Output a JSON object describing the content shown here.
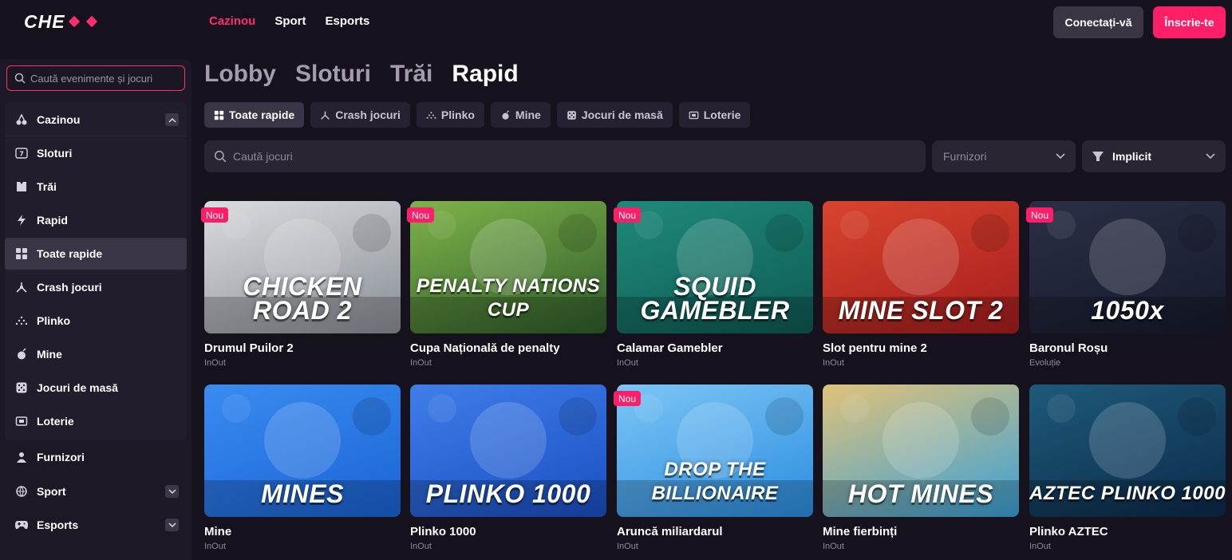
{
  "header": {
    "logo": "CHEXX",
    "nav": [
      {
        "label": "Cazinou",
        "active": true
      },
      {
        "label": "Sport",
        "active": false
      },
      {
        "label": "Esports",
        "active": false
      }
    ],
    "login_label": "Conectați-vă",
    "register_label": "Înscrie-te"
  },
  "sidebar": {
    "search_placeholder": "Caută evenimente și jocuri",
    "casino_label": "Cazinou",
    "casino_items": [
      {
        "label": "Sloturi",
        "icon": "slot-icon"
      },
      {
        "label": "Trăi",
        "icon": "live-icon"
      },
      {
        "label": "Rapid",
        "icon": "lightning-icon"
      },
      {
        "label": "Toate rapide",
        "icon": "grid-icon",
        "selected": true
      },
      {
        "label": "Crash jocuri",
        "icon": "crash-icon"
      },
      {
        "label": "Plinko",
        "icon": "plinko-icon"
      },
      {
        "label": "Mine",
        "icon": "mine-icon"
      },
      {
        "label": "Jocuri de masă",
        "icon": "dice-icon"
      },
      {
        "label": "Loterie",
        "icon": "lottery-icon"
      }
    ],
    "providers_label": "Furnizori",
    "sport_label": "Sport",
    "esports_label": "Esports"
  },
  "main": {
    "category_tabs": [
      {
        "label": "Lobby",
        "active": false
      },
      {
        "label": "Sloturi",
        "active": false
      },
      {
        "label": "Trăi",
        "active": false
      },
      {
        "label": "Rapid",
        "active": true
      }
    ],
    "chips": [
      {
        "label": "Toate rapide",
        "active": true
      },
      {
        "label": "Crash jocuri",
        "active": false
      },
      {
        "label": "Plinko",
        "active": false
      },
      {
        "label": "Mine",
        "active": false
      },
      {
        "label": "Jocuri de masă",
        "active": false
      },
      {
        "label": "Loterie",
        "active": false
      }
    ],
    "search_placeholder": "Caută jocuri",
    "providers_select": "Furnizori",
    "sort_select": "Implicit"
  },
  "games": [
    {
      "name": "Drumul Puilor 2",
      "provider": "InOut",
      "badge": "Nou",
      "art_title": "CHICKEN ROAD 2",
      "colors": [
        "#8a8f96",
        "#d9dde0"
      ]
    },
    {
      "name": "Cupa Națională de penalty",
      "provider": "InOut",
      "badge": "Nou",
      "art_title": "PENALTY NATIONS CUP",
      "colors": [
        "#2f5c2a",
        "#7fb34a"
      ]
    },
    {
      "name": "Calamar Gamebler",
      "provider": "InOut",
      "badge": "Nou",
      "art_title": "SQUID GAMEBLER",
      "colors": [
        "#0e5a54",
        "#1f8a7a"
      ]
    },
    {
      "name": "Slot pentru mine 2",
      "provider": "InOut",
      "badge": "",
      "art_title": "MINE SLOT 2",
      "colors": [
        "#a51d1d",
        "#d9442e"
      ]
    },
    {
      "name": "Baronul Roșu",
      "provider": "Evoluție",
      "badge": "Nou",
      "art_title": "1050x",
      "colors": [
        "#161a2c",
        "#2a2f46"
      ]
    },
    {
      "name": "Mine",
      "provider": "InOut",
      "badge": "",
      "art_title": "MINES",
      "colors": [
        "#1a63d6",
        "#3a8cf0"
      ]
    },
    {
      "name": "Plinko 1000",
      "provider": "InOut",
      "badge": "",
      "art_title": "PLINKO 1000",
      "colors": [
        "#1a4fc4",
        "#3f7ee8"
      ]
    },
    {
      "name": "Aruncă miliardarul",
      "provider": "InOut",
      "badge": "Nou",
      "art_title": "DROP THE BILLIONAIRE",
      "colors": [
        "#2b8de0",
        "#7cc6f5"
      ]
    },
    {
      "name": "Mine fierbinți",
      "provider": "InOut",
      "badge": "",
      "art_title": "HOT MINES",
      "colors": [
        "#3aa0d8",
        "#e0c27a"
      ]
    },
    {
      "name": "Plinko AZTEC",
      "provider": "InOut",
      "badge": "",
      "art_title": "AZTEC PLINKO 1000",
      "colors": [
        "#0c2a4a",
        "#1e5a7a"
      ]
    }
  ]
}
